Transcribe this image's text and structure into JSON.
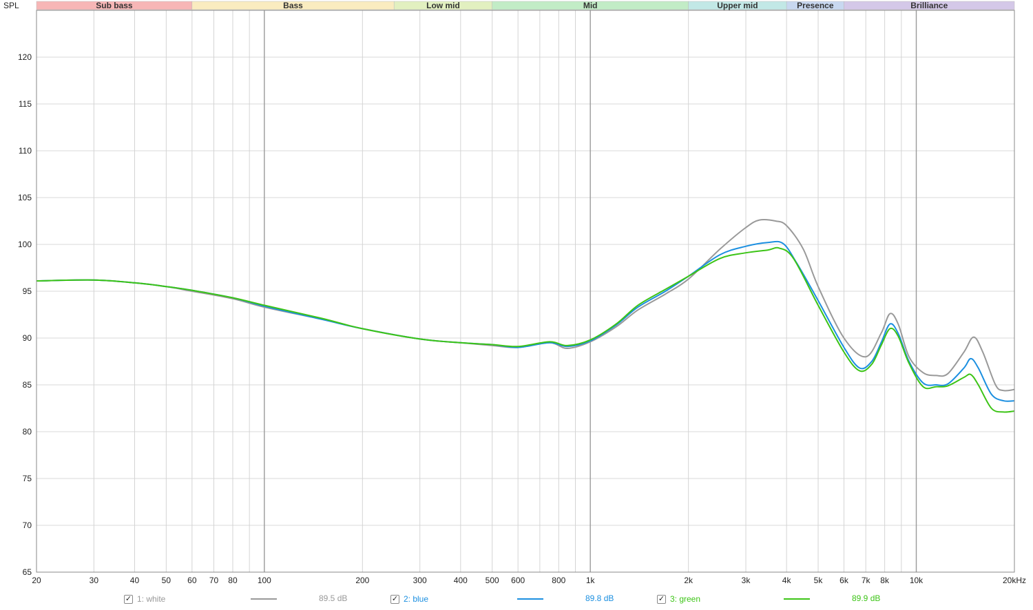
{
  "chart_data": {
    "type": "line",
    "ylabel": "SPL",
    "x_scale": "log",
    "xlim": [
      20,
      20000
    ],
    "ylim": [
      65,
      125
    ],
    "y_ticks": [
      65,
      70,
      75,
      80,
      85,
      90,
      95,
      100,
      105,
      110,
      115,
      120
    ],
    "x_ticks": [
      {
        "v": 20,
        "label": "20"
      },
      {
        "v": 30,
        "label": "30"
      },
      {
        "v": 40,
        "label": "40"
      },
      {
        "v": 50,
        "label": "50"
      },
      {
        "v": 60,
        "label": "60"
      },
      {
        "v": 70,
        "label": "70"
      },
      {
        "v": 80,
        "label": "80"
      },
      {
        "v": 100,
        "label": "100"
      },
      {
        "v": 200,
        "label": "200"
      },
      {
        "v": 300,
        "label": "300"
      },
      {
        "v": 400,
        "label": "400"
      },
      {
        "v": 500,
        "label": "500"
      },
      {
        "v": 600,
        "label": "600"
      },
      {
        "v": 800,
        "label": "800"
      },
      {
        "v": 1000,
        "label": "1k"
      },
      {
        "v": 2000,
        "label": "2k"
      },
      {
        "v": 3000,
        "label": "3k"
      },
      {
        "v": 4000,
        "label": "4k"
      },
      {
        "v": 5000,
        "label": "5k"
      },
      {
        "v": 6000,
        "label": "6k"
      },
      {
        "v": 7000,
        "label": "7k"
      },
      {
        "v": 8000,
        "label": "8k"
      },
      {
        "v": 10000,
        "label": "10k"
      },
      {
        "v": 20000,
        "label": "20kHz"
      }
    ],
    "bands": [
      {
        "name": "Sub bass",
        "from": 20,
        "to": 60,
        "color": "#f7b6b6"
      },
      {
        "name": "Bass",
        "from": 60,
        "to": 250,
        "color": "#faecc0"
      },
      {
        "name": "Low mid",
        "from": 250,
        "to": 500,
        "color": "#e2f0c0"
      },
      {
        "name": "Mid",
        "from": 500,
        "to": 2000,
        "color": "#c2ecc6"
      },
      {
        "name": "Upper mid",
        "from": 2000,
        "to": 4000,
        "color": "#c2e8e6"
      },
      {
        "name": "Presence",
        "from": 4000,
        "to": 6000,
        "color": "#c8d8f0"
      },
      {
        "name": "Brilliance",
        "from": 6000,
        "to": 20000,
        "color": "#d4c8e8"
      }
    ],
    "series": [
      {
        "name": "1: white",
        "color": "#999999",
        "level": "89.5 dB",
        "checked": true,
        "points": [
          [
            20,
            96.1
          ],
          [
            30,
            96.2
          ],
          [
            40,
            95.9
          ],
          [
            50,
            95.5
          ],
          [
            60,
            95.0
          ],
          [
            80,
            94.2
          ],
          [
            100,
            93.3
          ],
          [
            150,
            92.0
          ],
          [
            200,
            91.0
          ],
          [
            300,
            89.9
          ],
          [
            400,
            89.5
          ],
          [
            500,
            89.2
          ],
          [
            600,
            89.0
          ],
          [
            750,
            89.5
          ],
          [
            850,
            88.9
          ],
          [
            1000,
            89.6
          ],
          [
            1200,
            91.2
          ],
          [
            1400,
            93.0
          ],
          [
            1700,
            94.7
          ],
          [
            2000,
            96.3
          ],
          [
            2500,
            99.5
          ],
          [
            3000,
            101.8
          ],
          [
            3300,
            102.6
          ],
          [
            3700,
            102.5
          ],
          [
            4000,
            102.0
          ],
          [
            4500,
            99.5
          ],
          [
            5000,
            95.5
          ],
          [
            6000,
            90.0
          ],
          [
            7000,
            88.0
          ],
          [
            7800,
            90.5
          ],
          [
            8300,
            92.6
          ],
          [
            8800,
            91.5
          ],
          [
            9500,
            88.0
          ],
          [
            10500,
            86.3
          ],
          [
            11500,
            86.0
          ],
          [
            12500,
            86.2
          ],
          [
            14000,
            88.5
          ],
          [
            15000,
            90.1
          ],
          [
            16000,
            88.5
          ],
          [
            17500,
            85.0
          ],
          [
            18500,
            84.4
          ],
          [
            20000,
            84.5
          ]
        ]
      },
      {
        "name": "2: blue",
        "color": "#1b8fe0",
        "level": "89.8 dB",
        "checked": true,
        "points": [
          [
            20,
            96.1
          ],
          [
            30,
            96.2
          ],
          [
            40,
            95.9
          ],
          [
            50,
            95.5
          ],
          [
            60,
            95.1
          ],
          [
            80,
            94.3
          ],
          [
            100,
            93.4
          ],
          [
            150,
            92.0
          ],
          [
            200,
            91.0
          ],
          [
            300,
            89.9
          ],
          [
            400,
            89.5
          ],
          [
            500,
            89.3
          ],
          [
            600,
            89.0
          ],
          [
            750,
            89.5
          ],
          [
            850,
            89.1
          ],
          [
            1000,
            89.7
          ],
          [
            1200,
            91.4
          ],
          [
            1400,
            93.3
          ],
          [
            1700,
            95.0
          ],
          [
            2000,
            96.6
          ],
          [
            2500,
            98.9
          ],
          [
            3000,
            99.8
          ],
          [
            3500,
            100.2
          ],
          [
            3900,
            100.1
          ],
          [
            4300,
            98.0
          ],
          [
            5000,
            94.0
          ],
          [
            6000,
            89.0
          ],
          [
            6700,
            86.8
          ],
          [
            7300,
            87.5
          ],
          [
            7800,
            89.5
          ],
          [
            8300,
            91.5
          ],
          [
            8800,
            90.5
          ],
          [
            9500,
            87.5
          ],
          [
            10500,
            85.2
          ],
          [
            11500,
            85.0
          ],
          [
            12500,
            85.1
          ],
          [
            14000,
            86.8
          ],
          [
            14700,
            87.8
          ],
          [
            15500,
            86.8
          ],
          [
            17000,
            84.0
          ],
          [
            18500,
            83.3
          ],
          [
            20000,
            83.3
          ]
        ]
      },
      {
        "name": "3: green",
        "color": "#3cc416",
        "level": "89.9 dB",
        "checked": true,
        "points": [
          [
            20,
            96.1
          ],
          [
            30,
            96.2
          ],
          [
            40,
            95.9
          ],
          [
            50,
            95.5
          ],
          [
            60,
            95.1
          ],
          [
            80,
            94.3
          ],
          [
            100,
            93.5
          ],
          [
            150,
            92.1
          ],
          [
            200,
            91.0
          ],
          [
            300,
            89.9
          ],
          [
            400,
            89.5
          ],
          [
            500,
            89.3
          ],
          [
            600,
            89.1
          ],
          [
            750,
            89.6
          ],
          [
            850,
            89.2
          ],
          [
            1000,
            89.8
          ],
          [
            1200,
            91.5
          ],
          [
            1400,
            93.5
          ],
          [
            1700,
            95.2
          ],
          [
            2000,
            96.6
          ],
          [
            2500,
            98.5
          ],
          [
            3000,
            99.1
          ],
          [
            3500,
            99.4
          ],
          [
            3800,
            99.6
          ],
          [
            4200,
            98.5
          ],
          [
            5000,
            93.5
          ],
          [
            6000,
            88.5
          ],
          [
            6700,
            86.5
          ],
          [
            7300,
            87.2
          ],
          [
            7800,
            89.2
          ],
          [
            8300,
            91.0
          ],
          [
            8800,
            90.2
          ],
          [
            9500,
            87.3
          ],
          [
            10500,
            84.8
          ],
          [
            11500,
            84.8
          ],
          [
            12500,
            84.9
          ],
          [
            14000,
            85.8
          ],
          [
            14700,
            86.1
          ],
          [
            15500,
            85.0
          ],
          [
            17000,
            82.5
          ],
          [
            18500,
            82.1
          ],
          [
            20000,
            82.2
          ]
        ]
      }
    ]
  }
}
